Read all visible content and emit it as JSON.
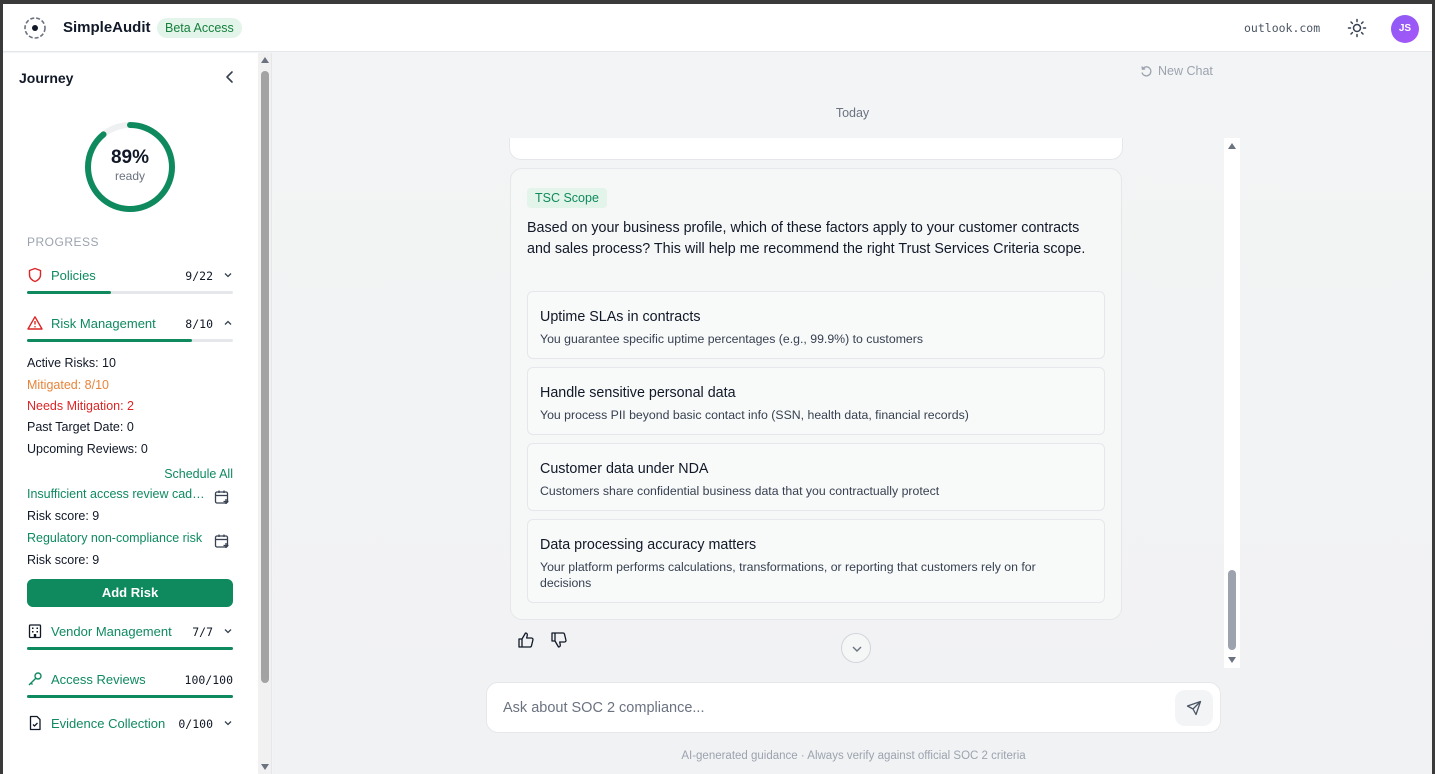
{
  "header": {
    "brand": "SimpleAudit",
    "badge": "Beta Access",
    "domain": "outlook.com",
    "avatar_initials": "JS",
    "avatar_color": "#8b5cf6",
    "theme_icon": "sun-icon"
  },
  "sidebar": {
    "title": "Journey",
    "readiness": {
      "percent_label": "89%",
      "sub": "ready",
      "value": 0.89
    },
    "progress_heading": "PROGRESS",
    "items": [
      {
        "label": "Policies",
        "count": "9/22",
        "progress": 0.41,
        "icon": "shield-icon",
        "icon_color": "#dc2626"
      },
      {
        "label": "Risk Management",
        "count": "8/10",
        "progress": 0.8,
        "icon": "warning-icon",
        "icon_color": "#dc2626"
      },
      {
        "label": "Vendor Management",
        "count": "7/7",
        "progress": 1.0,
        "icon": "building-icon",
        "icon_color": "#111827"
      },
      {
        "label": "Access Reviews",
        "count": "100/100",
        "progress": 1.0,
        "icon": "key-icon",
        "icon_color": "#0f8a5f"
      },
      {
        "label": "Evidence Collection",
        "count": "0/100",
        "progress": 0,
        "icon": "document-icon",
        "icon_color": "#111827"
      }
    ],
    "risk_details": {
      "active": "Active Risks: 10",
      "mitigated": "Mitigated: 8/10",
      "needs_mitigation": "Needs Mitigation: 2",
      "past_target": "Past Target Date: 0",
      "upcoming": "Upcoming Reviews: 0",
      "schedule_all": "Schedule All",
      "risks": [
        {
          "name": "Insufficient access review cadence",
          "score": "Risk score: 9"
        },
        {
          "name": "Regulatory non-compliance risk",
          "score": "Risk score: 9"
        }
      ],
      "add_button": "Add Risk"
    }
  },
  "main": {
    "new_chat": "New Chat",
    "date_divider": "Today",
    "message": {
      "tag": "TSC Scope",
      "question": "Based on your business profile, which of these factors apply to your customer contracts and sales process? This will help me recommend the right Trust Services Criteria scope.",
      "options": [
        {
          "title": "Uptime SLAs in contracts",
          "desc": "You guarantee specific uptime percentages (e.g., 99.9%) to customers"
        },
        {
          "title": "Handle sensitive personal data",
          "desc": "You process PII beyond basic contact info (SSN, health data, financial records)"
        },
        {
          "title": "Customer data under NDA",
          "desc": "Customers share confidential business data that you contractually protect"
        },
        {
          "title": "Data processing accuracy matters",
          "desc": "Your platform performs calculations, transformations, or reporting that customers rely on for decisions"
        }
      ]
    },
    "input_placeholder": "Ask about SOC 2 compliance...",
    "disclaimer": "AI-generated guidance · Always verify against official SOC 2 criteria"
  },
  "colors": {
    "accent": "#0f8a5f",
    "danger": "#dc2626",
    "warning": "#e8843a"
  }
}
